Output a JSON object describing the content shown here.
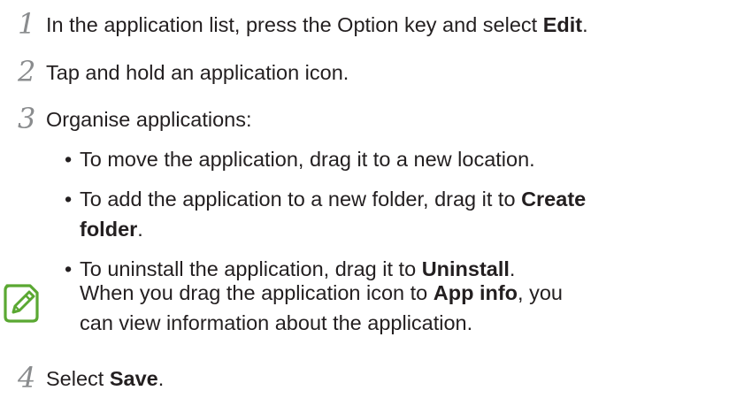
{
  "steps": [
    {
      "number": "1",
      "text_before": "In the application list, press the Option key and select ",
      "bold": "Edit",
      "text_after": "."
    },
    {
      "number": "2",
      "text": "Tap and hold an application icon."
    },
    {
      "number": "3",
      "text": "Organise applications:",
      "bullets": [
        {
          "text_before": "To move the application, drag it to a new location.",
          "bold": "",
          "text_after": ""
        },
        {
          "text_before": "To add the application to a new folder, drag it to ",
          "bold_line1": "Create",
          "bold_line2": "folder",
          "text_after": "."
        },
        {
          "text_before": "To uninstall the application, drag it to ",
          "bold": "Uninstall",
          "text_after": "."
        }
      ]
    },
    {
      "number": "4",
      "text_before": "Select ",
      "bold": "Save",
      "text_after": "."
    }
  ],
  "note": {
    "icon": "note-pencil-icon",
    "line1_before": "When you drag the application icon to ",
    "line1_bold": "App info",
    "line1_after": ", you",
    "line2": "can view information about the application."
  },
  "colors": {
    "text": "#231f20",
    "step_number": "#8a8c8e",
    "note_icon": "#5aa832"
  }
}
